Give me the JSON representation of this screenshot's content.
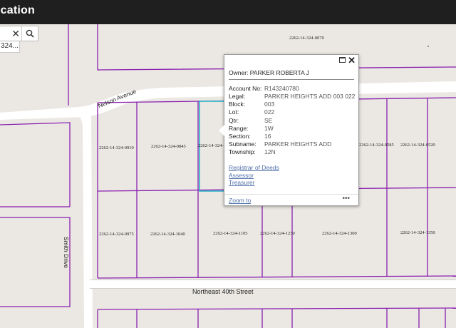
{
  "app": {
    "title": "ication"
  },
  "search": {
    "value": "",
    "clear_icon": "close-icon",
    "search_icon": "search-icon",
    "suggestion": "324..."
  },
  "map": {
    "parcel_color": "#8a1fb0",
    "highlight_color": "#1fb7c7",
    "parcels": [
      "2262-14-324-0070",
      "2262-14-324-0910",
      "2262-14-324-0845",
      "2262-14-324-",
      "2262-14-324-0585",
      "2262-14-324-0520",
      "2262-14-324-0975",
      "2262-14-324-1040",
      "2262-14-324-1105",
      "2262-14-324-1230",
      "2262-14-324-1300",
      "2262-14-324-1350"
    ],
    "streets": [
      "Nelson Avenue",
      "Smith Drive",
      "Northeast 40th Street"
    ]
  },
  "popup": {
    "owner": "Owner: PARKER ROBERTA J",
    "fields": [
      {
        "label": "Account No:",
        "value": "R143240780"
      },
      {
        "label": "Legal:",
        "value": "PARKER HEIGHTS ADD 003 022"
      },
      {
        "label": "Block:",
        "value": "003"
      },
      {
        "label": "Lot:",
        "value": "022"
      },
      {
        "label": "Qtr:",
        "value": "SE"
      },
      {
        "label": "Range:",
        "value": "1W"
      },
      {
        "label": "Section:",
        "value": "16"
      },
      {
        "label": "Subname:",
        "value": "PARKER HEIGHTS ADD"
      },
      {
        "label": "Township:",
        "value": "12N"
      }
    ],
    "links": [
      "Registrar of Deeds",
      "Assessor",
      "Treasurer"
    ],
    "zoom_label": "Zoom to",
    "more_label": "•••"
  }
}
